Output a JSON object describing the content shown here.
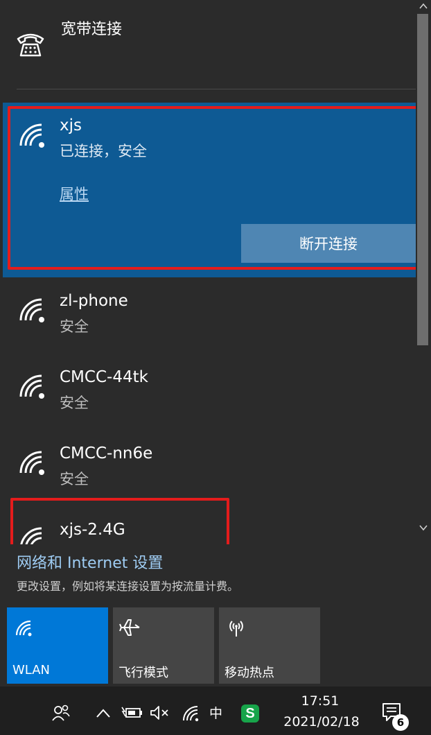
{
  "broadband": {
    "title": "宽带连接",
    "icon": "dial-up-phone-icon"
  },
  "networks": {
    "selected": {
      "name": "xjs",
      "status": "已连接，安全",
      "properties_label": "属性",
      "disconnect_label": "断开连接"
    },
    "items": [
      {
        "name": "zl-phone",
        "status": "安全"
      },
      {
        "name": "CMCC-44tk",
        "status": "安全"
      },
      {
        "name": "CMCC-nn6e",
        "status": "安全"
      },
      {
        "name": "xjs-2.4G",
        "status": ""
      }
    ]
  },
  "settings": {
    "link": "网络和 Internet 设置",
    "description": "更改设置，例如将某连接设置为按流量计费。"
  },
  "tiles": [
    {
      "label": "WLAN",
      "icon": "wifi-icon",
      "active": true
    },
    {
      "label": "飞行模式",
      "icon": "airplane-icon",
      "active": false
    },
    {
      "label": "移动热点",
      "icon": "hotspot-icon",
      "active": false
    }
  ],
  "taskbar": {
    "ime": "中",
    "sogou": "S",
    "time": "17:51",
    "date": "2021/02/18",
    "notification_count": "6"
  },
  "colors": {
    "selected_bg": "#0e5a94",
    "highlight_border": "#e41c1c",
    "active_tile": "#0078d7"
  }
}
